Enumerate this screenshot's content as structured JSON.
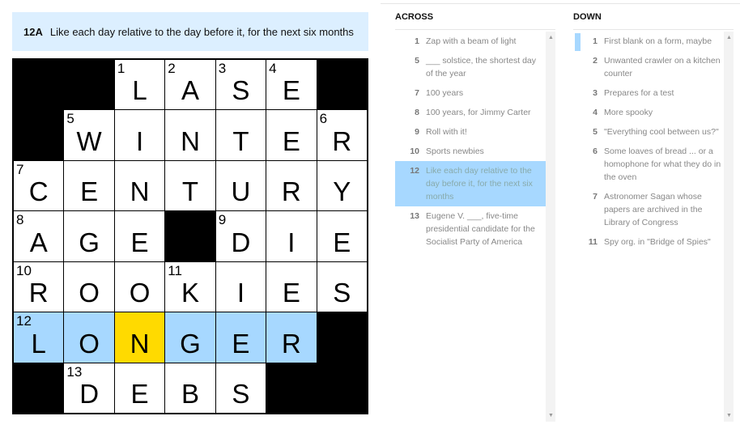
{
  "current_clue": {
    "number": "12A",
    "text": "Like each day relative to the day before it, for the next six months"
  },
  "colors": {
    "highlight": "#a7d8ff",
    "selected": "#ffda00",
    "clue_bar": "#dcefff"
  },
  "grid": [
    [
      {
        "b": 1
      },
      {
        "b": 1
      },
      {
        "n": "1",
        "l": "L"
      },
      {
        "n": "2",
        "l": "A"
      },
      {
        "n": "3",
        "l": "S"
      },
      {
        "n": "4",
        "l": "E"
      },
      {
        "b": 1
      }
    ],
    [
      {
        "b": 1
      },
      {
        "n": "5",
        "l": "W"
      },
      {
        "l": "I"
      },
      {
        "l": "N"
      },
      {
        "l": "T"
      },
      {
        "l": "E"
      },
      {
        "n": "6",
        "l": "R"
      }
    ],
    [
      {
        "n": "7",
        "l": "C"
      },
      {
        "l": "E"
      },
      {
        "l": "N"
      },
      {
        "l": "T"
      },
      {
        "l": "U"
      },
      {
        "l": "R"
      },
      {
        "l": "Y"
      }
    ],
    [
      {
        "n": "8",
        "l": "A"
      },
      {
        "l": "G"
      },
      {
        "l": "E"
      },
      {
        "b": 1
      },
      {
        "n": "9",
        "l": "D"
      },
      {
        "l": "I"
      },
      {
        "l": "E"
      }
    ],
    [
      {
        "n": "10",
        "l": "R"
      },
      {
        "l": "O"
      },
      {
        "l": "O"
      },
      {
        "n": "11",
        "l": "K"
      },
      {
        "l": "I"
      },
      {
        "l": "E"
      },
      {
        "l": "S"
      }
    ],
    [
      {
        "n": "12",
        "l": "L",
        "h": 1
      },
      {
        "l": "O",
        "h": 1
      },
      {
        "l": "N",
        "s": 1
      },
      {
        "l": "G",
        "h": 1
      },
      {
        "l": "E",
        "h": 1
      },
      {
        "l": "R",
        "h": 1
      },
      {
        "b": 1
      }
    ],
    [
      {
        "b": 1
      },
      {
        "n": "13",
        "l": "D"
      },
      {
        "l": "E"
      },
      {
        "l": "B"
      },
      {
        "l": "S"
      },
      {
        "b": 1
      },
      {
        "b": 1
      }
    ]
  ],
  "across": {
    "title": "ACROSS",
    "clues": [
      {
        "n": "1",
        "t": "Zap with a beam of light"
      },
      {
        "n": "5",
        "t": "___ solstice, the shortest day of the year"
      },
      {
        "n": "7",
        "t": "100 years"
      },
      {
        "n": "8",
        "t": "100 years, for Jimmy Carter"
      },
      {
        "n": "9",
        "t": "Roll with it!"
      },
      {
        "n": "10",
        "t": "Sports newbies"
      },
      {
        "n": "12",
        "t": "Like each day relative to the day before it, for the next six months",
        "active": true
      },
      {
        "n": "13",
        "t": "Eugene V. ___, five-time presidential candidate for the Socialist Party of America"
      }
    ]
  },
  "down": {
    "title": "DOWN",
    "clues": [
      {
        "n": "1",
        "t": "First blank on a form, maybe",
        "ref": true
      },
      {
        "n": "2",
        "t": "Unwanted crawler on a kitchen counter"
      },
      {
        "n": "3",
        "t": "Prepares for a test"
      },
      {
        "n": "4",
        "t": "More spooky"
      },
      {
        "n": "5",
        "t": "\"Everything cool between us?\""
      },
      {
        "n": "6",
        "t": "Some loaves of bread ... or a homophone for what they do in the oven"
      },
      {
        "n": "7",
        "t": "Astronomer Sagan whose papers are archived in the Library of Congress"
      },
      {
        "n": "11",
        "t": "Spy org. in \"Bridge of Spies\""
      }
    ]
  }
}
